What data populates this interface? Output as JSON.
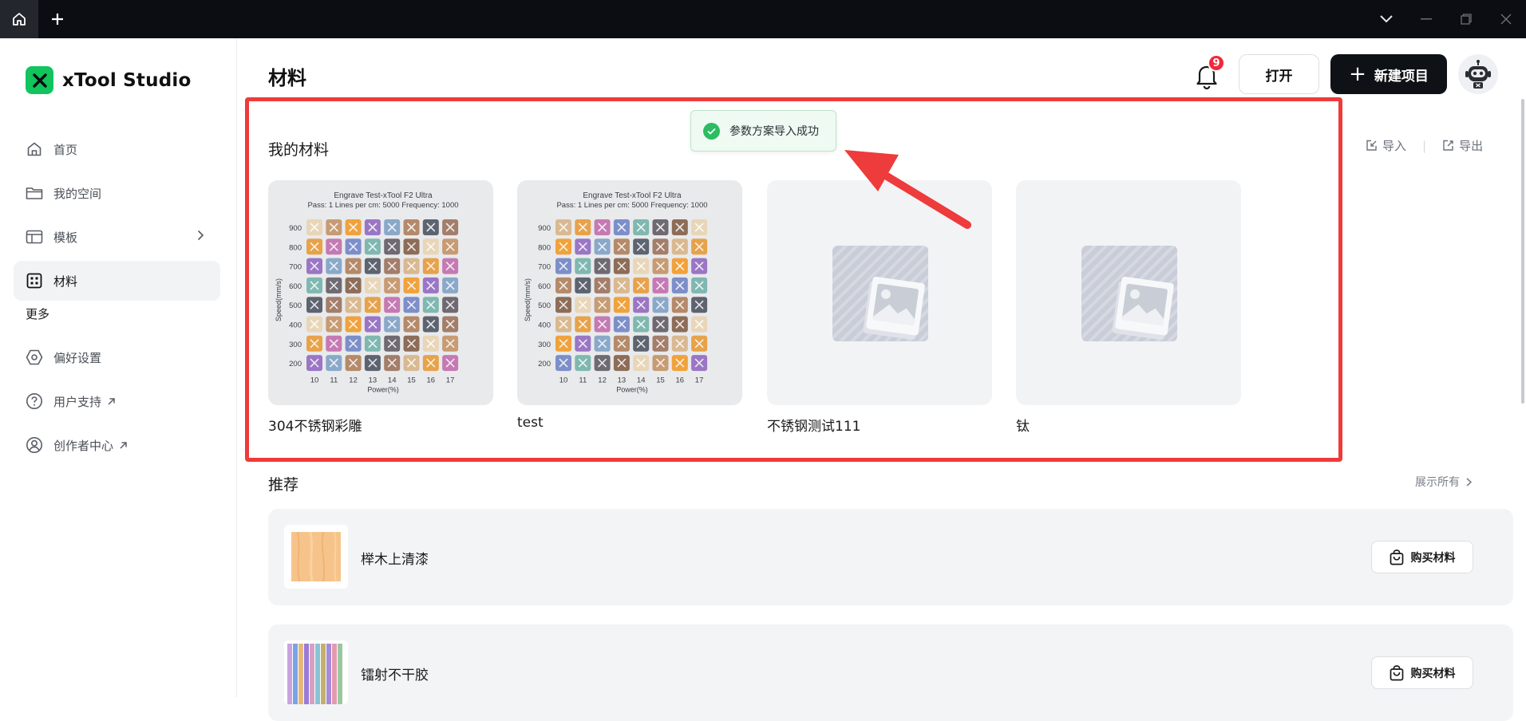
{
  "sidebar": {
    "app_name": "xTool Studio",
    "items": [
      {
        "label": "首页",
        "icon": "home-icon"
      },
      {
        "label": "我的空间",
        "icon": "folder-icon"
      },
      {
        "label": "模板",
        "icon": "template-icon"
      },
      {
        "label": "材料",
        "icon": "grid-icon",
        "active": true
      }
    ],
    "more_section": "更多",
    "more_items": [
      {
        "label": "偏好设置",
        "icon": "settings-icon"
      },
      {
        "label": "用户支持",
        "icon": "help-icon",
        "external": true
      },
      {
        "label": "创作者中心",
        "icon": "user-icon",
        "external": true
      }
    ]
  },
  "header": {
    "title": "材料",
    "notification_count": "9",
    "open_label": "打开",
    "new_project_label": "新建项目"
  },
  "toast": {
    "message": "参数方案导入成功",
    "status": "success"
  },
  "my_materials": {
    "title": "我的材料",
    "import_label": "导入",
    "export_label": "导出",
    "cards": [
      {
        "name": "304不锈钢彩雕",
        "thumbnail": "engrave-test-grid"
      },
      {
        "name": "test",
        "thumbnail": "engrave-test-grid"
      },
      {
        "name": "不锈钢测试111",
        "thumbnail": "image-placeholder"
      },
      {
        "name": "钛",
        "thumbnail": "image-placeholder"
      }
    ],
    "engrave_test": {
      "title": "Engrave Test-xTool F2 Ultra",
      "subtitle": "Pass: 1 Lines per cm: 5000 Frequency: 1000",
      "ylabel": "Speed(mm/s)",
      "xlabel": "Power(%)",
      "speeds": [
        "900",
        "800",
        "700",
        "600",
        "500",
        "400",
        "300",
        "200"
      ],
      "powers": [
        "10",
        "11",
        "12",
        "13",
        "14",
        "15",
        "16",
        "17"
      ]
    }
  },
  "recommended": {
    "title": "推荐",
    "show_all_label": "展示所有",
    "items": [
      {
        "name": "榉木上清漆",
        "buy_label": "购买材料",
        "thumbnail": "wood-swatch"
      },
      {
        "name": "镭射不干胶",
        "buy_label": "购买材料",
        "thumbnail": "laser-sticker-swatch"
      }
    ]
  },
  "colors": {
    "accent_green": "#11C45C",
    "highlight_red": "#EE3B3B",
    "badge_red": "#F0283C",
    "success_green": "#2CBC61"
  }
}
